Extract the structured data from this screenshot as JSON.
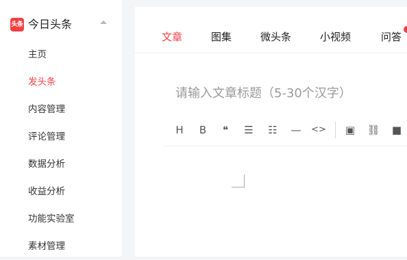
{
  "app": {
    "logo_text": "头条",
    "name": "今日头条"
  },
  "sidebar": {
    "items": [
      {
        "label": "主页"
      },
      {
        "label": "发头条",
        "active": true
      },
      {
        "label": "内容管理"
      },
      {
        "label": "评论管理"
      },
      {
        "label": "数据分析"
      },
      {
        "label": "收益分析"
      },
      {
        "label": "功能实验室"
      },
      {
        "label": "素材管理"
      }
    ]
  },
  "tabs": [
    {
      "label": "文章",
      "active": true
    },
    {
      "label": "图集"
    },
    {
      "label": "微头条"
    },
    {
      "label": "小视频"
    },
    {
      "label": "问答"
    }
  ],
  "editor": {
    "title_placeholder": "请输入文章标题（5-30个汉字）"
  },
  "toolbar": {
    "buttons": [
      {
        "icon": "heading-icon",
        "glyph": "H"
      },
      {
        "icon": "bold-icon",
        "glyph": "B"
      },
      {
        "icon": "quote-icon",
        "glyph": "❝"
      },
      {
        "icon": "bullet-list-icon",
        "glyph": "☰"
      },
      {
        "icon": "ordered-list-icon",
        "glyph": "☷"
      },
      {
        "icon": "horizontal-rule-icon",
        "glyph": "—"
      },
      {
        "icon": "code-icon",
        "glyph": "<>"
      },
      {
        "icon": "image-icon",
        "glyph": "▣"
      },
      {
        "icon": "link-icon",
        "glyph": "⛓"
      },
      {
        "icon": "video-icon",
        "glyph": "■"
      }
    ]
  },
  "colors": {
    "accent": "#f04142",
    "background": "#f4f5f6"
  }
}
